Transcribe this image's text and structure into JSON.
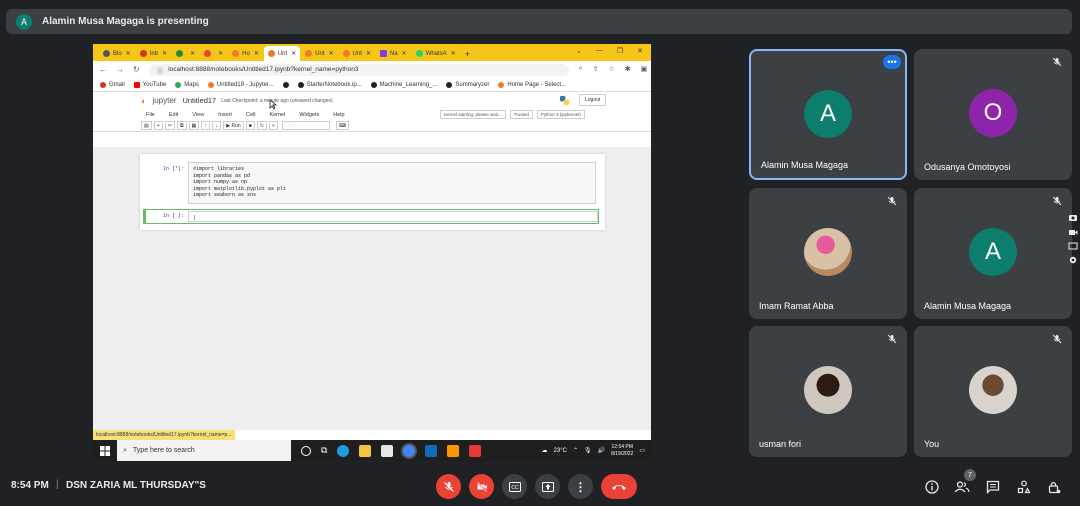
{
  "banner": {
    "avatar_letter": "A",
    "text": "Alamin Musa Magaga is presenting"
  },
  "screen": {
    "tabs": [
      {
        "label": "Blo",
        "color": "#555555"
      },
      {
        "label": "Inb",
        "color": "#d93025"
      },
      {
        "label": "",
        "color": "#1e8e3e"
      },
      {
        "label": "",
        "color": "#ea4335"
      },
      {
        "label": "Ho",
        "color": "#f37726"
      },
      {
        "label": "Unt",
        "color": "#f37726"
      },
      {
        "label": "Unt",
        "color": "#f37726"
      },
      {
        "label": "Unt",
        "color": "#f37726"
      },
      {
        "label": "Na",
        "color": "#7b3fe4"
      },
      {
        "label": "WhatsA",
        "color": "#25d366"
      }
    ],
    "new_tab": "+",
    "url": "localhost:8888/notebooks/Untitled17.ipynb?kernel_name=python3",
    "profile_letter": "A",
    "bookmarks": [
      "Gmail",
      "YouTube",
      "Maps",
      "Untitled19 - Jupyter...",
      "StarterNotebook.ip...",
      "Machine_Learning_...",
      "Summaryzer",
      "Home Page - Select..."
    ],
    "jupyter": {
      "brand": "jupyter",
      "title": "Untitled17",
      "checkpoint": "Last Checkpoint: a minute ago  (unsaved changes)",
      "logout": "Logout",
      "menu": [
        "File",
        "Edit",
        "View",
        "Insert",
        "Cell",
        "Kernel",
        "Widgets",
        "Help"
      ],
      "kernel_status": "Kernel starting, please wait...",
      "trusted": "Trusted",
      "kernel_name": "Python 3 (ipykernel)",
      "run_label": "Run",
      "cell_type": "Code",
      "cell1_prompt": "In [*]:",
      "cell1_code": [
        "#import libraries",
        "import pandas as pd",
        "import numpy as np",
        "import matplotlib.pyplot as plt",
        "import seaborn as sns"
      ],
      "cell2_prompt": "In [ ]:",
      "cell2_code": "|"
    },
    "status_url": "localhost:8888/notebooks/Untitled17.ipynb?kernel_name=p...",
    "taskbar": {
      "search_placeholder": "Type here to search",
      "temperature": "23°C",
      "time": "12:54 PM",
      "date": "8/19/2022"
    }
  },
  "participants": [
    {
      "name": "Alamin Musa Magaga",
      "letter": "A",
      "color": "#0d7d6d"
    },
    {
      "name": "Odusanya Omotoyosi",
      "letter": "O",
      "color": "#8e24aa"
    },
    {
      "name": "Imam Ramat Abba",
      "letter": "",
      "color": "#a98f7a"
    },
    {
      "name": "Alamin Musa Magaga",
      "letter": "A",
      "color": "#0d7d6d"
    },
    {
      "name": "usman fori",
      "letter": "",
      "color": "#5b4a3f"
    },
    {
      "name": "You",
      "letter": "",
      "color": "#8a7a6c"
    }
  ],
  "bottom": {
    "time": "8:54 PM",
    "separator": "|",
    "meeting_name": "DSN ZARIA ML THURSDAY\"S",
    "people_count": "7"
  }
}
